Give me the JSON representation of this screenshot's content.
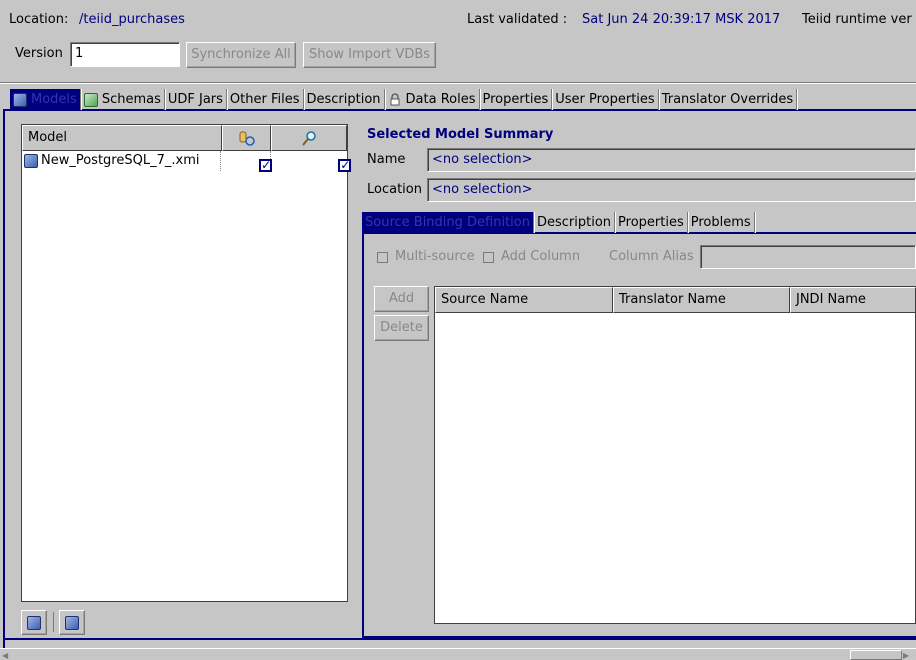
{
  "header": {
    "location_label": "Location:",
    "location_value": "/teiid_purchases",
    "last_validated_label": "Last validated :",
    "last_validated_value": "Sat Jun 24 20:39:17 MSK 2017",
    "runtime_label": "Teiid runtime ver"
  },
  "version": {
    "label": "Version",
    "value": "1",
    "sync_button": "Synchronize All",
    "import_button": "Show Import VDBs"
  },
  "main_tabs": [
    {
      "label": "Models",
      "icon": "model-cube-icon",
      "active": true
    },
    {
      "label": "Schemas",
      "icon": "schema-cube-icon"
    },
    {
      "label": "UDF Jars"
    },
    {
      "label": "Other Files"
    },
    {
      "label": "Description"
    },
    {
      "label": "Data Roles",
      "icon": "lock-icon"
    },
    {
      "label": "Properties"
    },
    {
      "label": "User Properties"
    },
    {
      "label": "Translator Overrides"
    }
  ],
  "models_table": {
    "col_model": "Model",
    "rows": [
      {
        "name": "New_PostgreSQL_7_.xmi",
        "col2_checked": true,
        "col3_checked": true
      }
    ]
  },
  "summary": {
    "title": "Selected Model Summary",
    "name_label": "Name",
    "name_value": "<no selection>",
    "location_label": "Location",
    "location_value": "<no selection>"
  },
  "sub_tabs": [
    {
      "label": "Source Binding Definition",
      "active": true
    },
    {
      "label": "Description"
    },
    {
      "label": "Properties"
    },
    {
      "label": "Problems"
    }
  ],
  "binding": {
    "multi_source": "Multi-source",
    "add_column": "Add Column",
    "column_alias": "Column Alias",
    "add_button": "Add",
    "delete_button": "Delete",
    "columns": [
      "Source Name",
      "Translator Name",
      "JNDI Name"
    ]
  },
  "colors": {
    "background": "#c6c6c6",
    "accent": "#00007f"
  }
}
